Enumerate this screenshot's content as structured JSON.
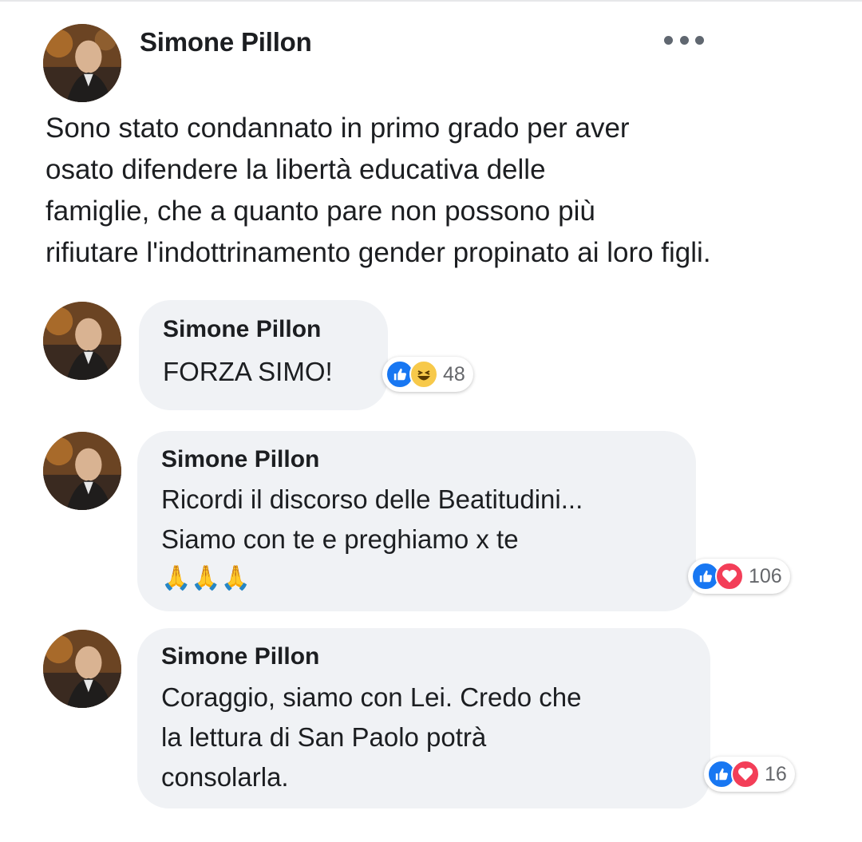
{
  "post": {
    "author": "Simone Pillon",
    "text": "Sono stato condannato in primo grado per aver\nosato difendere la libertà educativa delle\nfamiglie, che a quanto pare non possono più\nrifiutare l'indottrinamento gender propinato ai loro figli."
  },
  "comments": [
    {
      "author": "Simone Pillon",
      "text": "FORZA SIMO!",
      "reactions": [
        "like",
        "haha"
      ],
      "reaction_count": "48"
    },
    {
      "author": "Simone Pillon",
      "text": "Ricordi il discorso delle Beatitudini...\nSiamo con te e preghiamo x te",
      "emoji": "🙏🙏🙏",
      "reactions": [
        "like",
        "love"
      ],
      "reaction_count": "106"
    },
    {
      "author": "Simone Pillon",
      "text": "Coraggio, siamo con Lei. Credo che\nla lettura di San Paolo potrà\nconsolarla.",
      "reactions": [
        "like",
        "love"
      ],
      "reaction_count": "16"
    }
  ],
  "colors": {
    "like": "#1877f2",
    "love": "#f33e58",
    "haha": "#f7c94a",
    "bubble": "#f0f2f5"
  }
}
